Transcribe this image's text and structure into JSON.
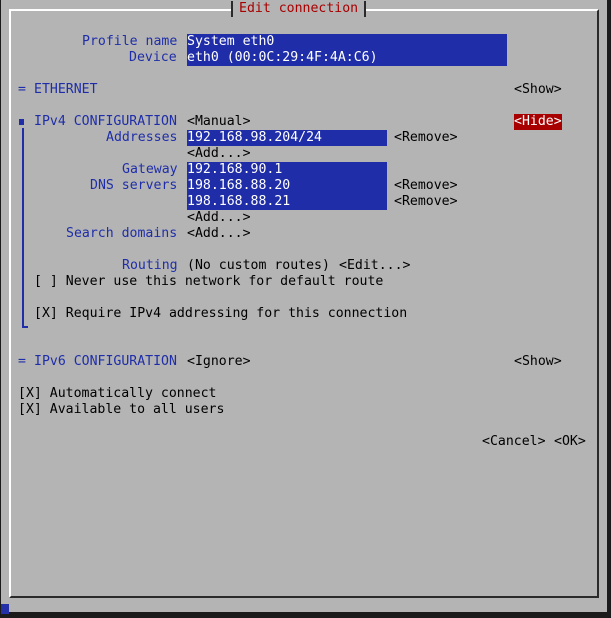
{
  "dialog": {
    "title": "Edit connection"
  },
  "profile": {
    "name_label": "Profile name",
    "name_value": "System eth0",
    "device_label": "Device",
    "device_value": "eth0 (00:0C:29:4F:4A:C6)"
  },
  "ethernet": {
    "marker": "=",
    "label": "ETHERNET",
    "toggle": "<Show>"
  },
  "ipv4": {
    "label": "IPv4 CONFIGURATION",
    "mode": "<Manual>",
    "toggle": "<Hide>",
    "addresses_label": "Addresses",
    "address_value": "192.168.98.204/24",
    "remove_label": "<Remove>",
    "add_label": "<Add...>",
    "gateway_label": "Gateway",
    "gateway_value": "192.168.90.1",
    "dns_label": "DNS servers",
    "dns": [
      "198.168.88.20",
      "198.168.88.21"
    ],
    "search_label": "Search domains",
    "routing_label": "Routing",
    "routing_value": "(No custom routes)",
    "edit_label": "<Edit...>",
    "never_default": "[ ] Never use this network for default route",
    "require_ipv4": "[X] Require IPv4 addressing for this connection"
  },
  "ipv6": {
    "marker": "=",
    "label": "IPv6 CONFIGURATION",
    "mode": "<Ignore>",
    "toggle": "<Show>"
  },
  "options": {
    "auto_connect": "[X] Automatically connect",
    "all_users": "[X] Available to all users"
  },
  "buttons": {
    "cancel": "<Cancel>",
    "ok": "<OK>"
  },
  "colors": {
    "background": "#b4b4b4",
    "field": "#1f2ea8",
    "label": "#1f2ea8",
    "accent": "#a80000"
  }
}
